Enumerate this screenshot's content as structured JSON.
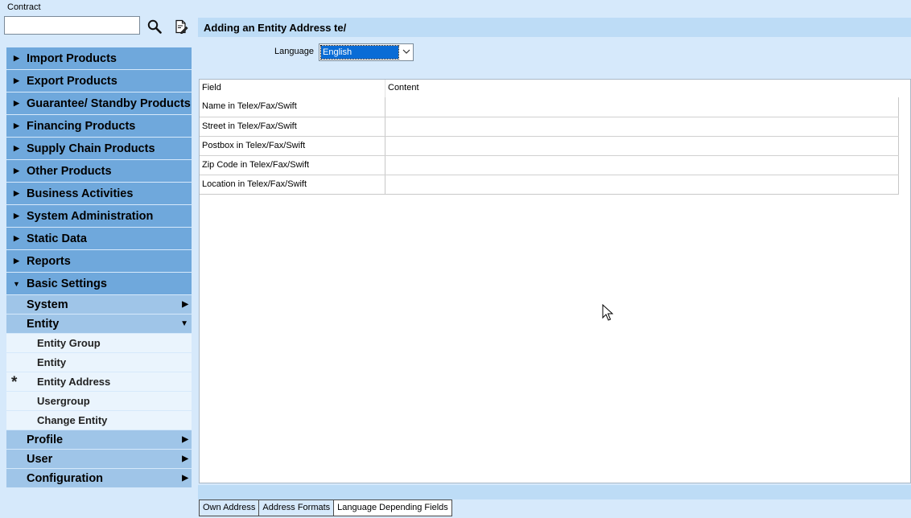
{
  "search": {
    "label": "Contract",
    "value": "",
    "search_icon": "magnifier-icon",
    "edit_icon": "document-pen-icon"
  },
  "nav": {
    "categories_top": [
      {
        "label": "Import Products"
      },
      {
        "label": "Export Products"
      },
      {
        "label": "Guarantee/ Standby Products"
      },
      {
        "label": "Financing Products"
      },
      {
        "label": "Supply Chain Products"
      },
      {
        "label": "Other Products"
      },
      {
        "label": "Business Activities"
      },
      {
        "label": "System Administration"
      },
      {
        "label": "Static Data"
      },
      {
        "label": "Reports"
      }
    ],
    "expanded_category": {
      "label": "Basic Settings"
    },
    "system": {
      "label": "System"
    },
    "entity": {
      "label": "Entity",
      "items": [
        {
          "label": "Entity Group",
          "current": false
        },
        {
          "label": "Entity",
          "current": false
        },
        {
          "label": "Entity Address",
          "current": true,
          "marker": "*"
        },
        {
          "label": "Usergroup",
          "current": false
        },
        {
          "label": "Change Entity",
          "current": false
        }
      ]
    },
    "subs_after": [
      {
        "label": "Profile"
      },
      {
        "label": "User"
      },
      {
        "label": "Configuration"
      }
    ]
  },
  "form": {
    "title": "Adding an Entity Address te/",
    "language_label": "Language",
    "language_value": "English"
  },
  "grid": {
    "headers": [
      "Field",
      "Content"
    ],
    "rows": [
      {
        "field": "Name in Telex/Fax/Swift",
        "content": ""
      },
      {
        "field": "Street in Telex/Fax/Swift",
        "content": ""
      },
      {
        "field": "Postbox in Telex/Fax/Swift",
        "content": ""
      },
      {
        "field": "Zip Code in Telex/Fax/Swift",
        "content": ""
      },
      {
        "field": "Location in Telex/Fax/Swift",
        "content": ""
      }
    ]
  },
  "tabs": [
    {
      "label": "Own Address",
      "active": false
    },
    {
      "label": "Address Formats",
      "active": false
    },
    {
      "label": "Language Depending Fields",
      "active": true
    }
  ],
  "colors": {
    "background": "#d6e9fb",
    "nav_category": "#6fa8dc",
    "nav_sub": "#9fc5e8",
    "nav_leaf": "#eaf4fd",
    "selection": "#0a6cd6"
  }
}
